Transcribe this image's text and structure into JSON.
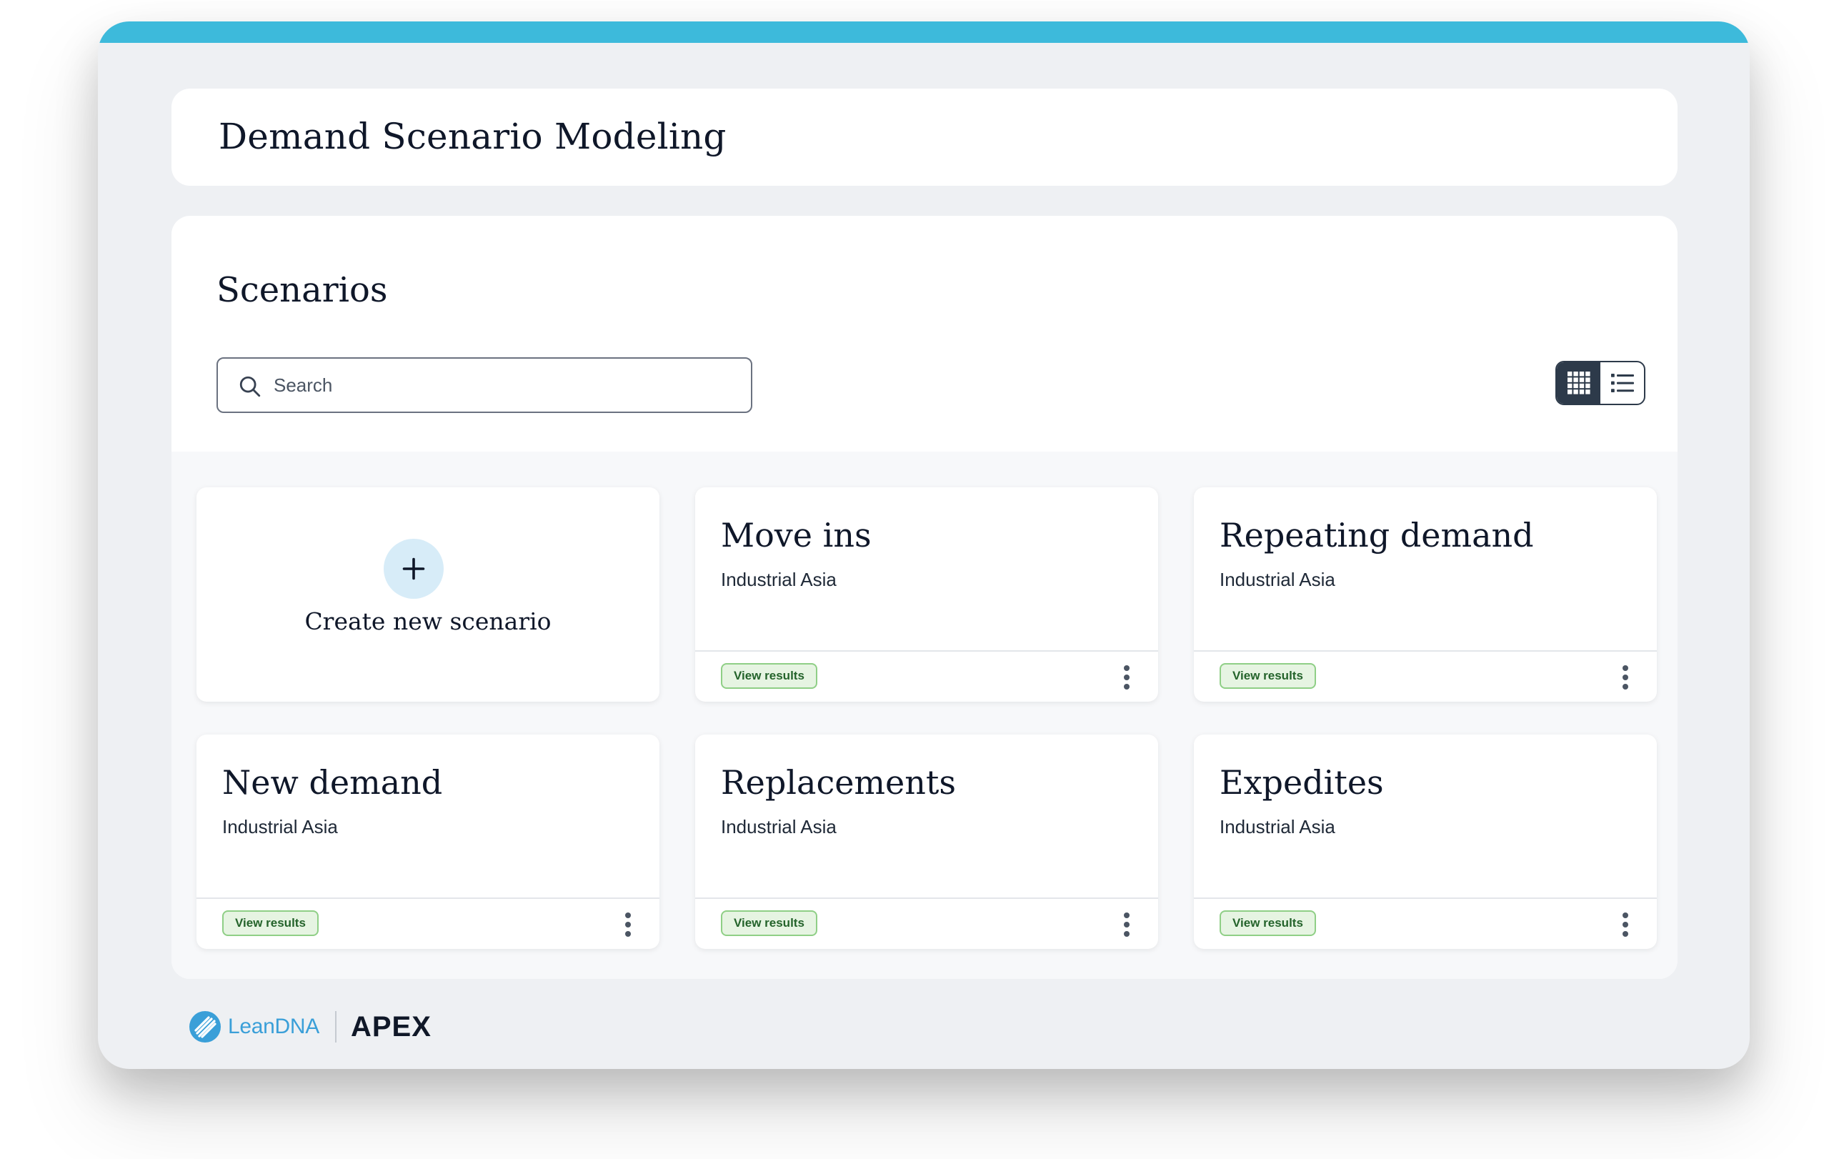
{
  "app": {
    "title": "Demand Scenario Modeling"
  },
  "section": {
    "title": "Scenarios"
  },
  "search": {
    "placeholder": "Search",
    "value": ""
  },
  "view_toggle": {
    "options": [
      "grid-view",
      "list-view"
    ],
    "selected": "grid-view"
  },
  "create_card": {
    "label": "Create new scenario"
  },
  "scenarios": [
    {
      "name": "Move ins",
      "subtitle": "Industrial Asia",
      "action": "View results"
    },
    {
      "name": "Repeating demand",
      "subtitle": "Industrial Asia",
      "action": "View results"
    },
    {
      "name": "New demand",
      "subtitle": "Industrial Asia",
      "action": "View results"
    },
    {
      "name": "Replacements",
      "subtitle": "Industrial Asia",
      "action": "View results"
    },
    {
      "name": "Expedites",
      "subtitle": "Industrial Asia",
      "action": "View results"
    }
  ],
  "footer": {
    "brand": "LeanDNA",
    "product": "APEX"
  },
  "colors": {
    "accent_bar": "#3dbadb",
    "badge_bg": "#e6f4e2",
    "badge_border": "#8fcf86",
    "badge_text": "#24632b",
    "toggle_active": "#2d3a4a",
    "brand_blue": "#3a9fd8"
  }
}
